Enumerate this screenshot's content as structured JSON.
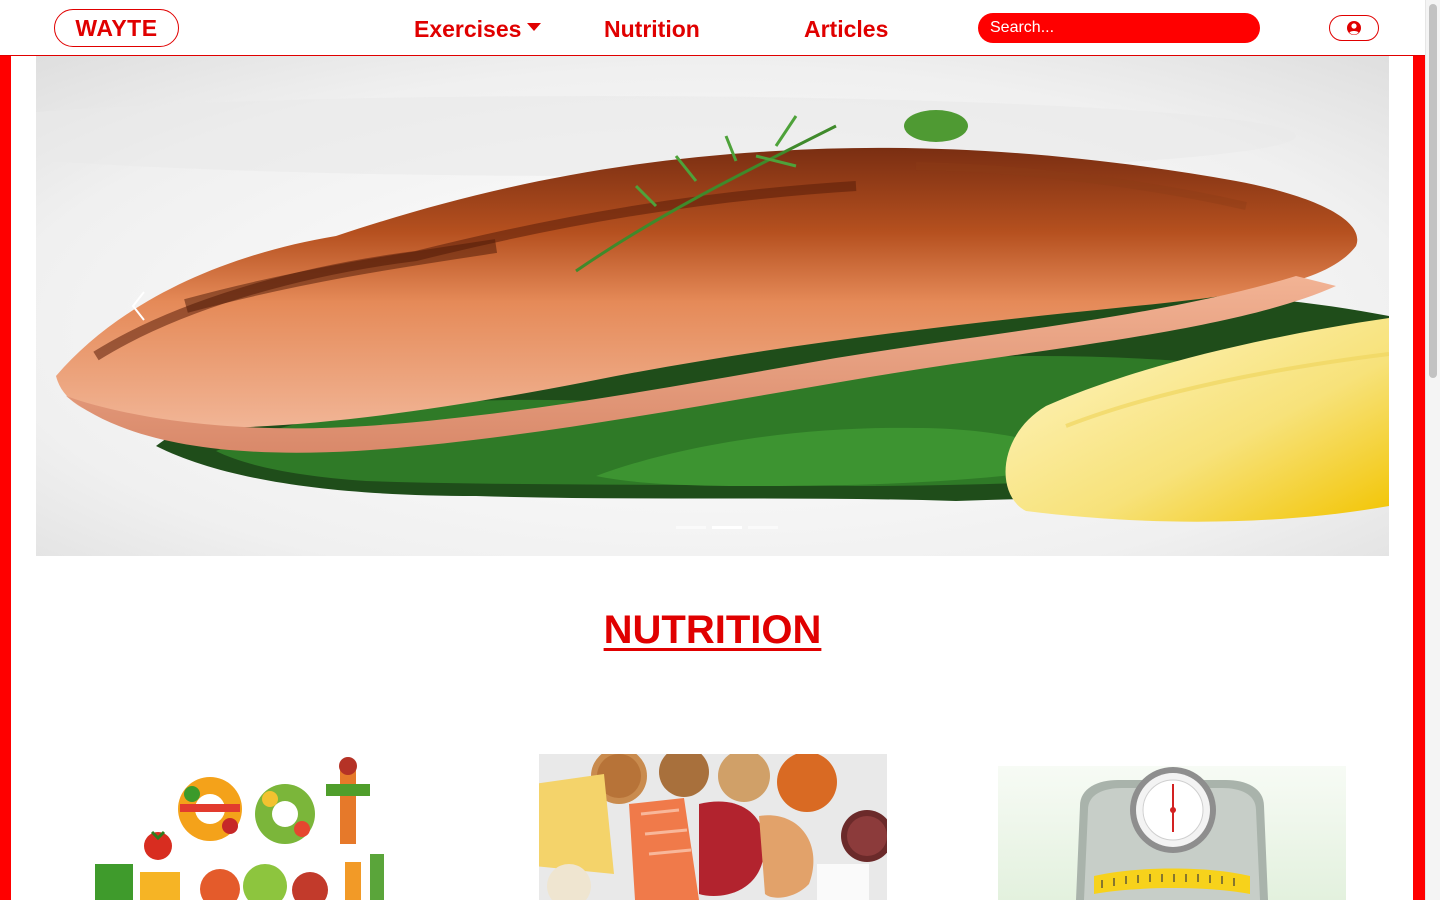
{
  "nav": {
    "brand": "WAYTE",
    "links": [
      "Exercises",
      "Nutrition",
      "Articles"
    ],
    "search_placeholder": "Search...",
    "user_icon": "user-circle-icon"
  },
  "carousel": {
    "indicator_count": 3,
    "active_index": 1,
    "prev_icon": "chevron-left-icon"
  },
  "section": {
    "title": "NUTRITION"
  },
  "colors": {
    "accent": "#ff0000",
    "accent_text": "#e00000"
  }
}
